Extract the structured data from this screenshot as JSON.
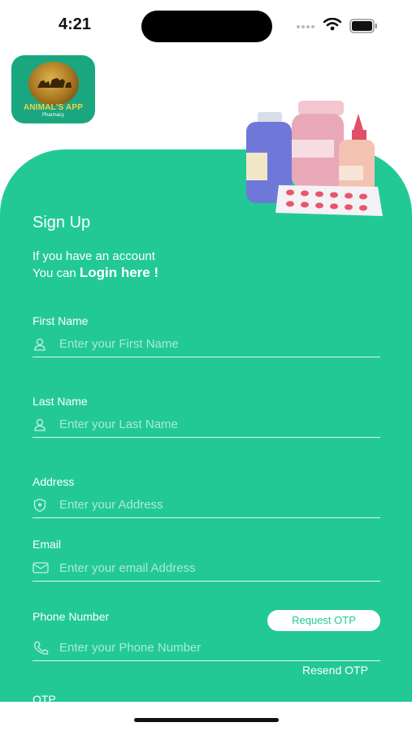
{
  "status_bar": {
    "time": "4:21"
  },
  "logo": {
    "title": "ANIMAL'S APP",
    "subtitle": "Pharmacy"
  },
  "header": {
    "title": "Sign Up",
    "line1": "If you have an account",
    "line2_prefix": "You can ",
    "login_link": "Login here !"
  },
  "fields": {
    "first_name": {
      "label": "First Name",
      "placeholder": "Enter your First Name"
    },
    "last_name": {
      "label": "Last Name",
      "placeholder": "Enter your Last Name"
    },
    "address": {
      "label": "Address",
      "placeholder": "Enter your Address"
    },
    "email": {
      "label": "Email",
      "placeholder": "Enter your email Address"
    },
    "phone": {
      "label": "Phone Number",
      "placeholder": "Enter your Phone Number"
    }
  },
  "buttons": {
    "request_otp": "Request OTP",
    "resend_otp": "Resend OTP"
  },
  "otp": {
    "label": "OTP"
  },
  "colors": {
    "primary": "#22c995",
    "text": "#ffffff"
  }
}
